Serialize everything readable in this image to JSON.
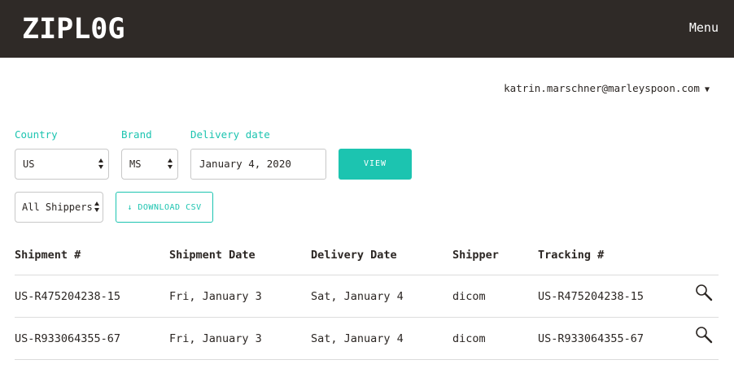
{
  "header": {
    "logo": "ZIPL0G",
    "menu_label": "Menu"
  },
  "user": {
    "email": "katrin.marschner@marleyspoon.com",
    "caret": "▼"
  },
  "filters": {
    "country_label": "Country",
    "country_value": "US",
    "brand_label": "Brand",
    "brand_value": "MS",
    "delivery_date_label": "Delivery date",
    "delivery_date_value": "January 4, 2020",
    "view_button": "VIEW",
    "shipper_value": "All Shippers",
    "download_csv_button": "↓ DOWNLOAD CSV"
  },
  "colors": {
    "header_bg": "#2f2a27",
    "accent": "#1cc4b0",
    "text": "#2b2623"
  },
  "table": {
    "columns": [
      "Shipment #",
      "Shipment Date",
      "Delivery Date",
      "Shipper",
      "Tracking #"
    ],
    "rows": [
      {
        "shipment": "US-R475204238-15",
        "shipment_date": "Fri, January 3",
        "delivery_date": "Sat, January 4",
        "shipper": "dicom",
        "tracking": "US-R475204238-15",
        "action_icon": "magnifier-icon"
      },
      {
        "shipment": "US-R933064355-67",
        "shipment_date": "Fri, January 3",
        "delivery_date": "Sat, January 4",
        "shipper": "dicom",
        "tracking": "US-R933064355-67",
        "action_icon": "magnifier-icon"
      }
    ]
  }
}
